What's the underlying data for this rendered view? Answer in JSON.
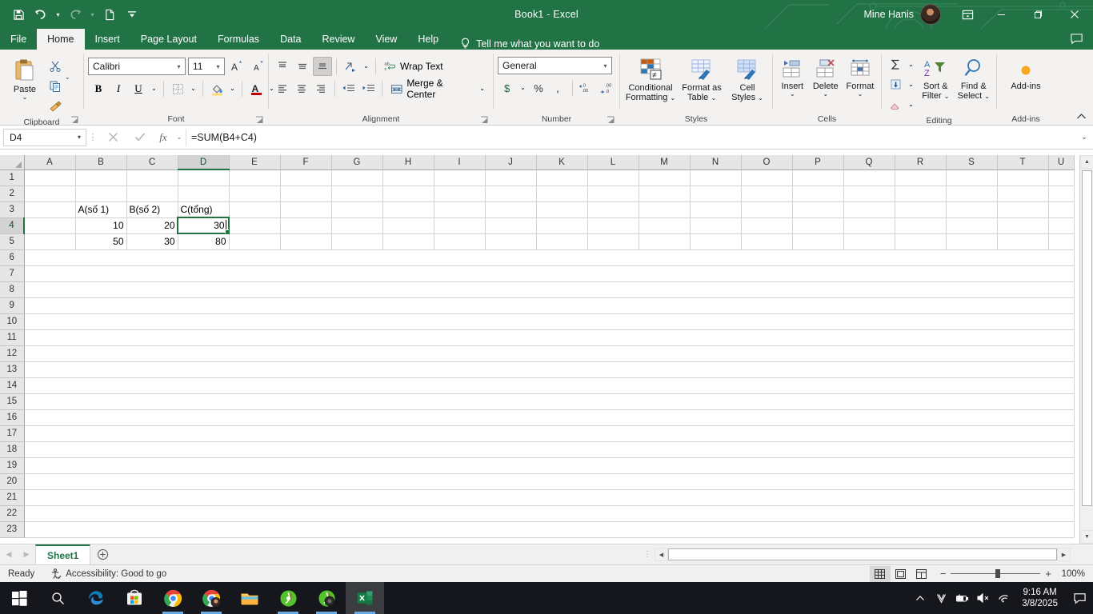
{
  "titlebar": {
    "title": "Book1  -  Excel",
    "account_name": "Mine Hanis",
    "qat": [
      {
        "name": "save",
        "label": "Save"
      },
      {
        "name": "undo",
        "label": "Undo"
      },
      {
        "name": "redo",
        "label": "Redo"
      },
      {
        "name": "new",
        "label": "New"
      },
      {
        "name": "customize",
        "label": "Customize Quick Access Toolbar"
      }
    ],
    "window_buttons": [
      "Minimize",
      "Restore Down",
      "Close"
    ],
    "ribbon_display_options": "Ribbon Display Options"
  },
  "tabs": [
    {
      "label": "File",
      "active": false
    },
    {
      "label": "Home",
      "active": true
    },
    {
      "label": "Insert",
      "active": false
    },
    {
      "label": "Page Layout",
      "active": false
    },
    {
      "label": "Formulas",
      "active": false
    },
    {
      "label": "Data",
      "active": false
    },
    {
      "label": "Review",
      "active": false
    },
    {
      "label": "View",
      "active": false
    },
    {
      "label": "Help",
      "active": false
    }
  ],
  "tell_me": "Tell me what you want to do",
  "ribbon": {
    "clipboard": {
      "group_label": "Clipboard",
      "paste_label": "Paste",
      "cut_label": "Cut",
      "copy_label": "Copy",
      "format_painter_label": "Format Painter"
    },
    "font": {
      "group_label": "Font",
      "font_name": "Calibri",
      "font_size": "11",
      "grow_label": "Increase Font Size",
      "shrink_label": "Decrease Font Size",
      "bold_label": "B",
      "italic_label": "I",
      "underline_label": "U",
      "borders_label": "Borders",
      "fill_color_label": "Fill Color",
      "font_color_label": "Font Color"
    },
    "alignment": {
      "group_label": "Alignment",
      "wrap_text_label": "Wrap Text",
      "merge_center_label": "Merge & Center",
      "top_align_label": "Top Align",
      "middle_align_label": "Middle Align",
      "bottom_align_label": "Bottom Align",
      "orientation_label": "Orientation",
      "align_left_label": "Align Left",
      "center_label": "Center",
      "align_right_label": "Align Right",
      "decrease_indent_label": "Decrease Indent",
      "increase_indent_label": "Increase Indent"
    },
    "number": {
      "group_label": "Number",
      "format": "General",
      "accounting_label": "Accounting Number Format",
      "percent_label": "%",
      "comma_label": "Comma Style",
      "increase_decimal_label": "Increase Decimal",
      "decrease_decimal_label": "Decrease Decimal"
    },
    "styles": {
      "group_label": "Styles",
      "conditional_formatting": "Conditional\nFormatting",
      "conditional_formatting_l1": "Conditional",
      "conditional_formatting_l2": "Formatting",
      "format_as_table_l1": "Format as",
      "format_as_table_l2": "Table",
      "cell_styles_l1": "Cell",
      "cell_styles_l2": "Styles"
    },
    "cells": {
      "group_label": "Cells",
      "insert_label": "Insert",
      "delete_label": "Delete",
      "format_label": "Format"
    },
    "editing": {
      "group_label": "Editing",
      "autosum_label": "AutoSum",
      "fill_label": "Fill",
      "clear_label": "Clear",
      "sort_filter_l1": "Sort &",
      "sort_filter_l2": "Filter",
      "find_select_l1": "Find &",
      "find_select_l2": "Select"
    },
    "addins": {
      "group_label": "Add-ins",
      "addins_label": "Add-ins"
    },
    "collapse_label": "Collapse the Ribbon"
  },
  "formula_bar": {
    "name_box": "D4",
    "cancel_label": "Cancel",
    "enter_label": "Enter",
    "insert_function_label": "Insert Function",
    "formula": "=SUM(B4+C4)",
    "expand_label": "Expand Formula Bar"
  },
  "grid": {
    "columns": [
      "A",
      "B",
      "C",
      "D",
      "E",
      "F",
      "G",
      "H",
      "I",
      "J",
      "K",
      "L",
      "M",
      "N",
      "O",
      "P",
      "Q",
      "R",
      "S",
      "T",
      "U"
    ],
    "selected_column": "D",
    "selected_row": 4,
    "rows": [
      1,
      2,
      3,
      4,
      5,
      6,
      7,
      8,
      9,
      10,
      11,
      12,
      13,
      14,
      15,
      16,
      17,
      18,
      19,
      20,
      21,
      22,
      23
    ],
    "cells": {
      "B3": {
        "value": "A(số 1)",
        "align": "left"
      },
      "C3": {
        "value": "B(số 2)",
        "align": "left"
      },
      "D3": {
        "value": "C(tổng)",
        "align": "left"
      },
      "B4": {
        "value": "10",
        "align": "right"
      },
      "C4": {
        "value": "20",
        "align": "right"
      },
      "D4": {
        "value": "30",
        "align": "right",
        "selected": true
      },
      "B5": {
        "value": "50",
        "align": "right"
      },
      "C5": {
        "value": "30",
        "align": "right"
      },
      "D5": {
        "value": "80",
        "align": "right"
      }
    }
  },
  "sheet_tabs": {
    "prev_label": "Previous Sheet",
    "next_label": "Next Sheet",
    "sheets": [
      {
        "name": "Sheet1",
        "active": true
      }
    ],
    "add_sheet_label": "New sheet"
  },
  "status_bar": {
    "mode": "Ready",
    "accessibility": "Accessibility: Good to go",
    "views": [
      {
        "name": "normal-view",
        "label": "Normal",
        "active": true
      },
      {
        "name": "page-layout-view",
        "label": "Page Layout",
        "active": false
      },
      {
        "name": "page-break-preview",
        "label": "Page Break Preview",
        "active": false
      }
    ],
    "zoom_out_label": "Zoom Out",
    "zoom_in_label": "Zoom In",
    "zoom": "100%"
  },
  "taskbar": {
    "items": [
      {
        "name": "start-button",
        "label": "Start"
      },
      {
        "name": "search-icon",
        "label": "Search"
      },
      {
        "name": "edge-icon",
        "label": "Microsoft Edge"
      },
      {
        "name": "store-icon",
        "label": "Microsoft Store"
      },
      {
        "name": "chrome-icon",
        "label": "Google Chrome"
      },
      {
        "name": "chrome-profile-icon",
        "label": "Google Chrome"
      },
      {
        "name": "file-explorer-icon",
        "label": "File Explorer"
      },
      {
        "name": "camtasia-icon",
        "label": "Camtasia"
      },
      {
        "name": "camtasia-recorder-icon",
        "label": "Camtasia Recorder"
      },
      {
        "name": "excel-icon",
        "label": "Excel"
      }
    ],
    "tray": {
      "show_hidden_label": "Show hidden icons",
      "vpn_label": "VPN",
      "battery_label": "Battery",
      "volume_label": "Volume muted",
      "network_label": "Network",
      "time": "9:16 AM",
      "date": "3/8/2025",
      "action_center_label": "Notifications"
    }
  },
  "colors": {
    "brand_green": "#217346",
    "ribbon_bg": "#f3f2f1",
    "taskbar_bg": "#15171c"
  }
}
